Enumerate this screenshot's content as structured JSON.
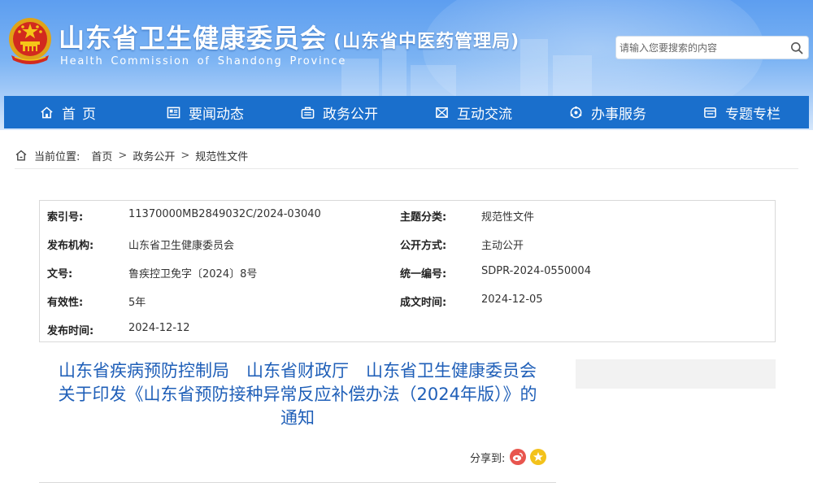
{
  "header": {
    "title": "山东省卫生健康委员会",
    "title_sub": "(山东省中医药管理局)",
    "title_en": "Health Commission of Shandong Province",
    "search_placeholder": "请输入您要搜索的内容"
  },
  "nav": {
    "items": [
      {
        "label": "首页",
        "icon": "home-icon"
      },
      {
        "label": "要闻动态",
        "icon": "news-icon"
      },
      {
        "label": "政务公开",
        "icon": "briefcase-icon"
      },
      {
        "label": "互动交流",
        "icon": "interaction-icon"
      },
      {
        "label": "办事服务",
        "icon": "service-icon"
      },
      {
        "label": "专题专栏",
        "icon": "column-icon"
      }
    ]
  },
  "breadcrumb": {
    "label": "当前位置:",
    "items": [
      "首页",
      "政务公开",
      "规范性文件"
    ],
    "separator": ">"
  },
  "meta": {
    "index_no_key": "索引号:",
    "index_no": "11370000MB2849032C/2024-03040",
    "topic_key": "主题分类:",
    "topic": "规范性文件",
    "issuer_key": "发布机构:",
    "issuer": "山东省卫生健康委员会",
    "open_mode_key": "公开方式:",
    "open_mode": "主动公开",
    "doc_no_key": "文号:",
    "doc_no": "鲁疾控卫免字〔2024〕8号",
    "unified_no_key": "统一编号:",
    "unified_no": "SDPR-2024-0550004",
    "validity_key": "有效性:",
    "validity": "5年",
    "written_date_key": "成文时间:",
    "written_date": "2024-12-05",
    "publish_date_key": "发布时间:",
    "publish_date": "2024-12-12"
  },
  "article": {
    "title_line1": "山东省疾病预防控制局　山东省财政厅　山东省卫生健康委员会",
    "title_line2": "关于印发《山东省预防接种异常反应补偿办法（2024年版）》的",
    "title_line3": "通知"
  },
  "share": {
    "label": "分享到:"
  },
  "colors": {
    "nav_bg": "#1a6fcc",
    "title_blue": "#1f5fb8"
  }
}
